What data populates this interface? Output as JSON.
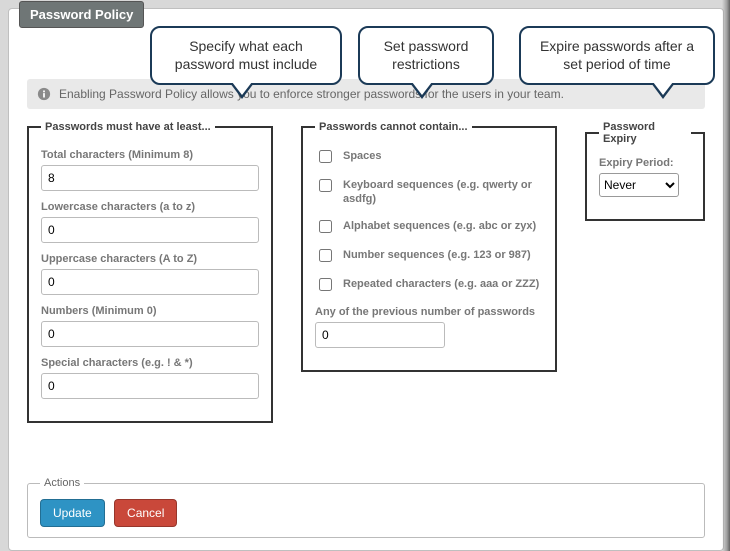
{
  "panel": {
    "title": "Password Policy"
  },
  "info": {
    "text": "Enabling Password Policy allows you to enforce stronger passwords for the users in your team."
  },
  "callouts": {
    "must": "Specify what each password must include",
    "cannot": "Set password restrictions",
    "expiry": "Expire passwords after a set period of time"
  },
  "must": {
    "legend": "Passwords must have at least...",
    "total_label": "Total characters (Minimum 8)",
    "total_value": "8",
    "lower_label": "Lowercase characters (a to z)",
    "lower_value": "0",
    "upper_label": "Uppercase characters (A to Z)",
    "upper_value": "0",
    "numbers_label": "Numbers (Minimum 0)",
    "numbers_value": "0",
    "special_label": "Special characters (e.g. ! & *)",
    "special_value": "0"
  },
  "cannot": {
    "legend": "Passwords cannot contain...",
    "spaces": "Spaces",
    "kbseq": "Keyboard sequences (e.g. qwerty or asdfg)",
    "alphaseq": "Alphabet sequences (e.g. abc or zyx)",
    "numseq": "Number sequences (e.g. 123 or 987)",
    "repeat": "Repeated characters (e.g. aaa or ZZZ)",
    "prev_label": "Any of the previous number of passwords",
    "prev_value": "0"
  },
  "expiry": {
    "legend": "Password Expiry",
    "label": "Expiry Period:",
    "value": "Never"
  },
  "actions": {
    "legend": "Actions",
    "update": "Update",
    "cancel": "Cancel"
  }
}
